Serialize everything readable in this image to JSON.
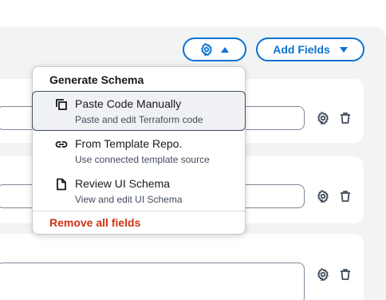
{
  "toolbar": {
    "settings_icon": "gear-icon",
    "settings_caret": "caret-up-icon",
    "add_fields_label": "Add Fields",
    "add_fields_caret": "caret-down-icon"
  },
  "rows": [
    {
      "settings_icon": "gear-icon",
      "delete_icon": "trash-icon"
    },
    {
      "settings_icon": "gear-icon",
      "delete_icon": "trash-icon"
    },
    {
      "settings_icon": "gear-icon",
      "delete_icon": "trash-icon"
    }
  ],
  "menu": {
    "header": "Generate Schema",
    "items": [
      {
        "label": "Paste Code Manually",
        "description": "Paste and edit Terraform code",
        "icon": "copy-icon"
      },
      {
        "label": "From Template Repo.",
        "description": "Use connected template source",
        "icon": "link-icon"
      },
      {
        "label": "Review UI Schema",
        "description": "View and edit UI Schema",
        "icon": "file-icon"
      }
    ],
    "remove_all_label": "Remove all fields"
  },
  "colors": {
    "accent": "#0972d3",
    "danger": "#d13212",
    "panel_background": "#f2f3f3"
  }
}
